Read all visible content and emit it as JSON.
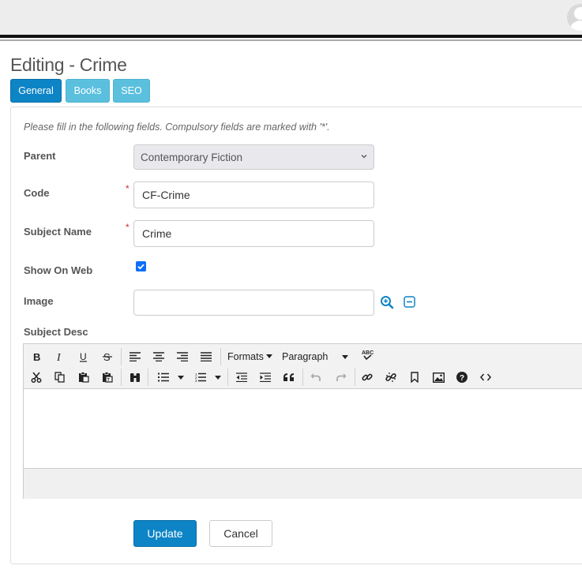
{
  "header": {
    "avatar_icon": "user-avatar-icon"
  },
  "page": {
    "title": "Editing - Crime"
  },
  "tabs": [
    {
      "label": "General",
      "active": true
    },
    {
      "label": "Books",
      "active": false
    },
    {
      "label": "SEO",
      "active": false
    }
  ],
  "form": {
    "instructions": "Please fill in the following fields. Compulsory fields are marked with '*'.",
    "required_marker": "*",
    "parent": {
      "label": "Parent",
      "value": "Contemporary Fiction"
    },
    "code": {
      "label": "Code",
      "value": "CF-Crime",
      "required": true
    },
    "subject_name": {
      "label": "Subject Name",
      "value": "Crime",
      "required": true
    },
    "show_on_web": {
      "label": "Show On Web",
      "checked": true
    },
    "image": {
      "label": "Image",
      "value": "",
      "browse_icon": "zoom-in-icon",
      "clear_icon": "minus-square-icon"
    },
    "subject_desc": {
      "label": "Subject Desc"
    }
  },
  "editor": {
    "formats_label": "Formats",
    "paragraph_label": "Paragraph",
    "content": ""
  },
  "actions": {
    "update_label": "Update",
    "cancel_label": "Cancel"
  },
  "colors": {
    "primary": "#0d84c6",
    "info": "#5bc0de",
    "required": "#c9302c"
  }
}
